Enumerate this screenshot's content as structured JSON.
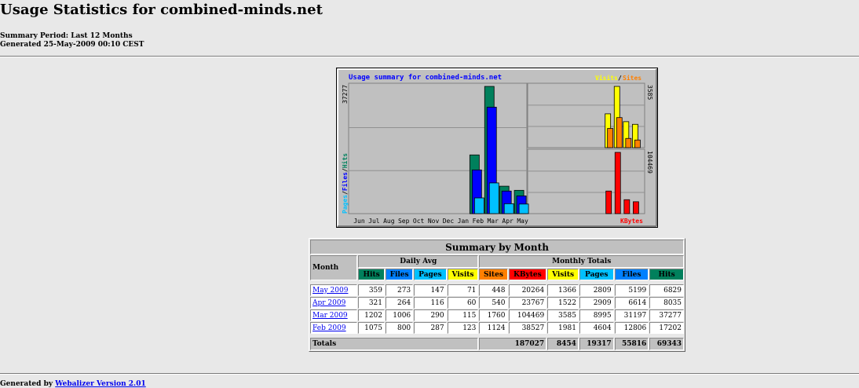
{
  "header": {
    "title": "Usage Statistics for combined-minds.net",
    "summary_period": "Summary Period: Last 12 Months",
    "generated": "Generated 25-May-2009 00:10 CEST"
  },
  "graph": {
    "title": "Usage summary for combined-minds.net",
    "left_axis_max": "37277",
    "left_axis_label_pages": "Pages",
    "left_axis_label_files": "Files",
    "left_axis_label_hits": "Hits",
    "right_top_max": "3585",
    "right_bottom_max": "104469",
    "legend_visits": "Visits",
    "legend_sites": "Sites",
    "legend_kbytes": "KBytes",
    "months": [
      "Jun",
      "Jul",
      "Aug",
      "Sep",
      "Oct",
      "Nov",
      "Dec",
      "Jan",
      "Feb",
      "Mar",
      "Apr",
      "May"
    ],
    "colors": {
      "hits": "#00805c",
      "files": "#0000ff",
      "pages": "#00c0ff",
      "visits": "#ffff00",
      "sites": "#ff8000",
      "kbytes": "#ff0000",
      "title": "#0000ff",
      "panel": "#c0c0c0"
    }
  },
  "chart_data": {
    "type": "bar",
    "categories": [
      "Jun",
      "Jul",
      "Aug",
      "Sep",
      "Oct",
      "Nov",
      "Dec",
      "Jan",
      "Feb",
      "Mar",
      "Apr",
      "May"
    ],
    "series": [
      {
        "name": "Hits",
        "values": [
          0,
          0,
          0,
          0,
          0,
          0,
          0,
          0,
          17202,
          37277,
          8035,
          6829
        ]
      },
      {
        "name": "Files",
        "values": [
          0,
          0,
          0,
          0,
          0,
          0,
          0,
          0,
          12806,
          31197,
          6614,
          5199
        ]
      },
      {
        "name": "Pages",
        "values": [
          0,
          0,
          0,
          0,
          0,
          0,
          0,
          0,
          4604,
          8995,
          2909,
          2809
        ]
      },
      {
        "name": "Visits",
        "values": [
          0,
          0,
          0,
          0,
          0,
          0,
          0,
          0,
          1981,
          3585,
          1522,
          1366
        ]
      },
      {
        "name": "Sites",
        "values": [
          0,
          0,
          0,
          0,
          0,
          0,
          0,
          0,
          1124,
          1760,
          540,
          448
        ]
      },
      {
        "name": "KBytes",
        "values": [
          0,
          0,
          0,
          0,
          0,
          0,
          0,
          0,
          38527,
          104469,
          23767,
          20264
        ]
      }
    ],
    "title": "Usage summary for combined-minds.net"
  },
  "table": {
    "title": "Summary by Month",
    "month_header": "Month",
    "daily_avg_header": "Daily Avg",
    "monthly_totals_header": "Monthly Totals",
    "columns": [
      {
        "label": "Hits",
        "color": "#00805c"
      },
      {
        "label": "Files",
        "color": "#0080ff"
      },
      {
        "label": "Pages",
        "color": "#00c0ff"
      },
      {
        "label": "Visits",
        "color": "#ffff00"
      },
      {
        "label": "Sites",
        "color": "#ff8000"
      },
      {
        "label": "KBytes",
        "color": "#ff0000"
      },
      {
        "label": "Visits",
        "color": "#ffff00"
      },
      {
        "label": "Pages",
        "color": "#00c0ff"
      },
      {
        "label": "Files",
        "color": "#0080ff"
      },
      {
        "label": "Hits",
        "color": "#00805c"
      }
    ],
    "rows": [
      {
        "month": "May 2009",
        "cells": [
          "359",
          "273",
          "147",
          "71",
          "448",
          "20264",
          "1366",
          "2809",
          "5199",
          "6829"
        ]
      },
      {
        "month": "Apr 2009",
        "cells": [
          "321",
          "264",
          "116",
          "60",
          "540",
          "23767",
          "1522",
          "2909",
          "6614",
          "8035"
        ]
      },
      {
        "month": "Mar 2009",
        "cells": [
          "1202",
          "1006",
          "290",
          "115",
          "1760",
          "104469",
          "3585",
          "8995",
          "31197",
          "37277"
        ]
      },
      {
        "month": "Feb 2009",
        "cells": [
          "1075",
          "800",
          "287",
          "123",
          "1124",
          "38527",
          "1981",
          "4604",
          "12806",
          "17202"
        ]
      }
    ],
    "totals": {
      "label": "Totals",
      "cells": [
        "187027",
        "8454",
        "19317",
        "55816",
        "69343"
      ]
    }
  },
  "footer": {
    "prefix": "Generated by",
    "link": "Webalizer Version 2.01"
  }
}
